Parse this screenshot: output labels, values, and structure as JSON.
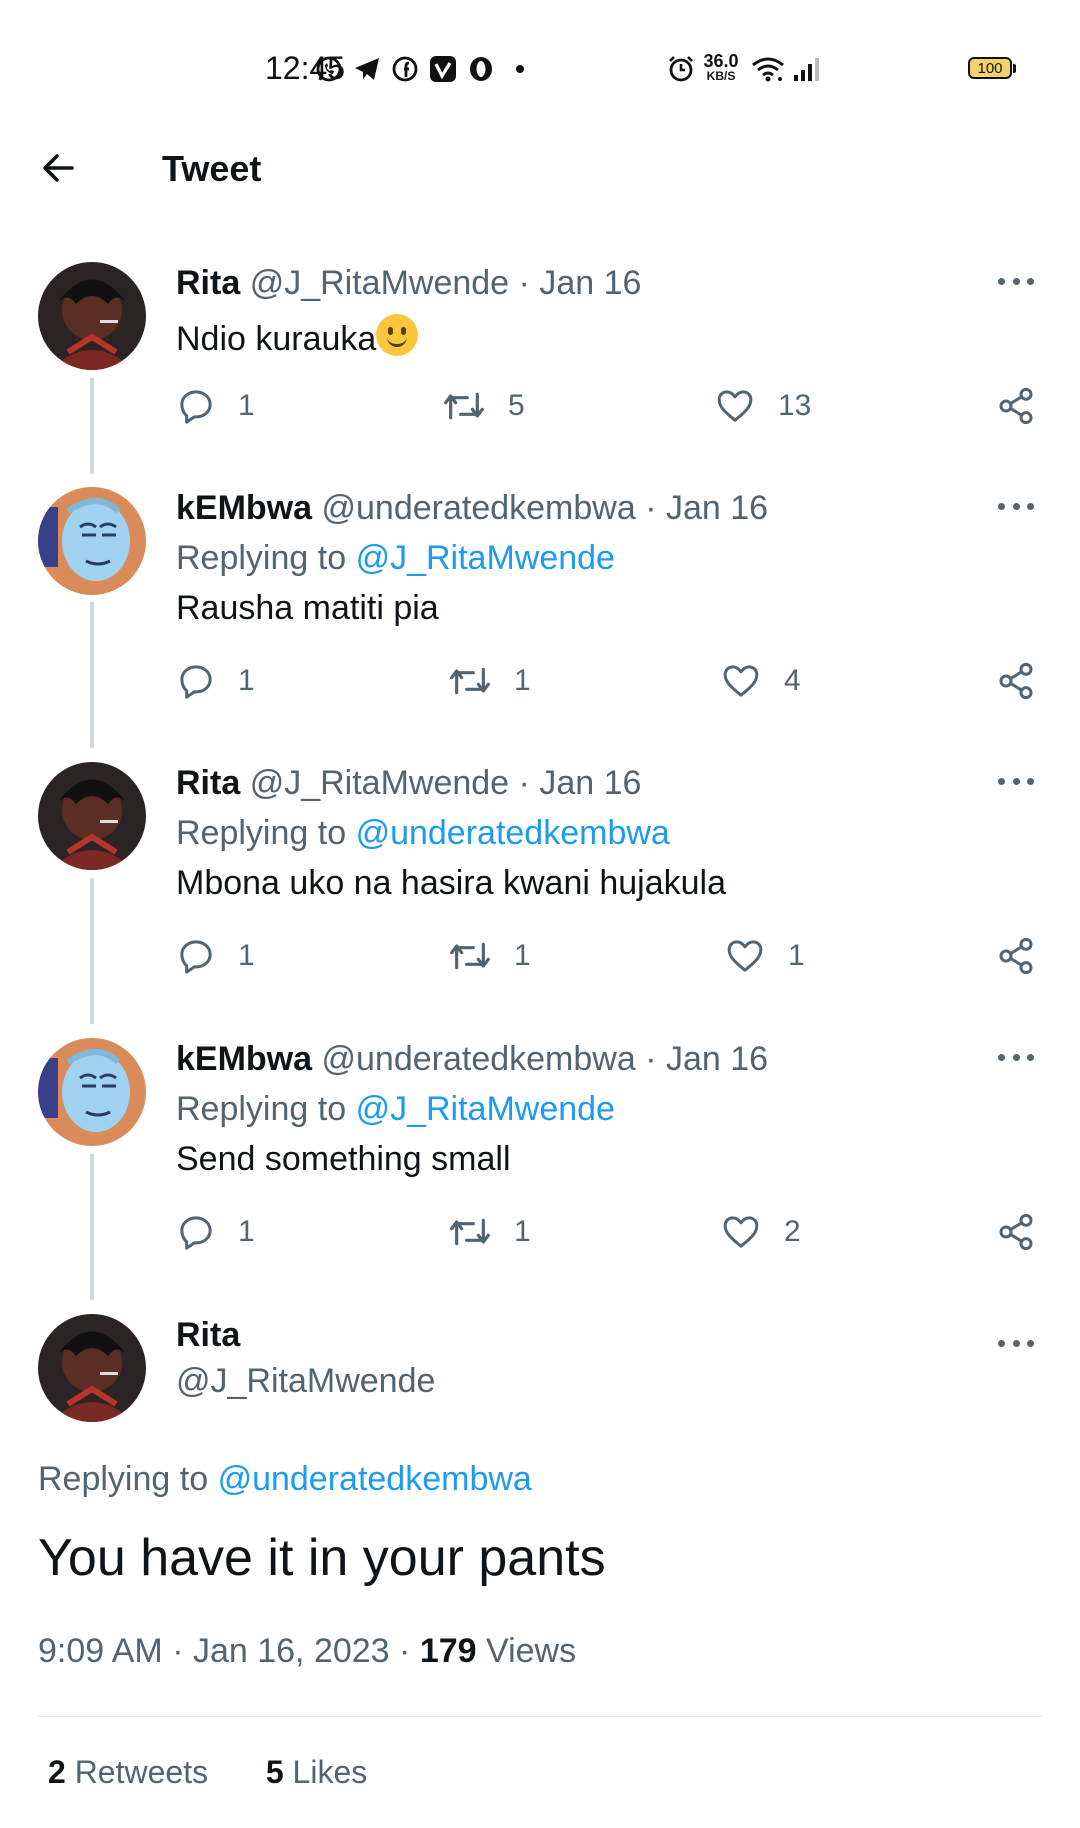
{
  "status_bar": {
    "time": "12:45",
    "net_speed_value": "36.0",
    "net_speed_unit": "KB/S",
    "battery": "100",
    "icons": [
      "whatsapp-icon",
      "telegram-icon",
      "facebook-icon",
      "vimeo-icon",
      "opera-icon",
      "dot-icon",
      "alarm-icon",
      "wifi-icon",
      "signal-icon",
      "battery-icon"
    ]
  },
  "header": {
    "title": "Tweet",
    "back_icon": "arrow-left-icon"
  },
  "thread": [
    {
      "name": "Rita",
      "handle": "@J_RitaMwende",
      "date": "· Jan 16",
      "replying_to": null,
      "text": "Ndio kurauka",
      "replies": "1",
      "retweets": "5",
      "likes": "13"
    },
    {
      "name": "kEMbwa",
      "handle": "@underatedkembwa",
      "date": "· Jan 16",
      "replying_label": "Replying to",
      "replying_to": "@J_RitaMwende",
      "text": "Rausha matiti pia",
      "replies": "1",
      "retweets": "1",
      "likes": "4"
    },
    {
      "name": "Rita",
      "handle": "@J_RitaMwende",
      "date": "· Jan 16",
      "replying_label": "Replying to",
      "replying_to": "@underatedkembwa",
      "text": "Mbona uko na hasira kwani hujakula",
      "replies": "1",
      "retweets": "1",
      "likes": "1"
    },
    {
      "name": "kEMbwa",
      "handle": "@underatedkembwa",
      "date": "· Jan 16",
      "replying_label": "Replying to",
      "replying_to": "@J_RitaMwende",
      "text": "Send something small",
      "replies": "1",
      "retweets": "1",
      "likes": "2"
    }
  ],
  "main_tweet": {
    "name": "Rita",
    "handle": "@J_RitaMwende",
    "replying_label": "Replying to",
    "replying_to": "@underatedkembwa",
    "text": "You have it in your pants",
    "time": "9:09 AM",
    "date": "· Jan 16, 2023 ·",
    "views_count": "179",
    "views_label": "Views",
    "retweets_count": "2",
    "retweets_label": "Retweets",
    "likes_count": "5",
    "likes_label": "Likes"
  },
  "colors": {
    "link": "#1d9bf0",
    "muted": "#536471",
    "text": "#0f1419",
    "thread_line": "#cfd9de"
  }
}
